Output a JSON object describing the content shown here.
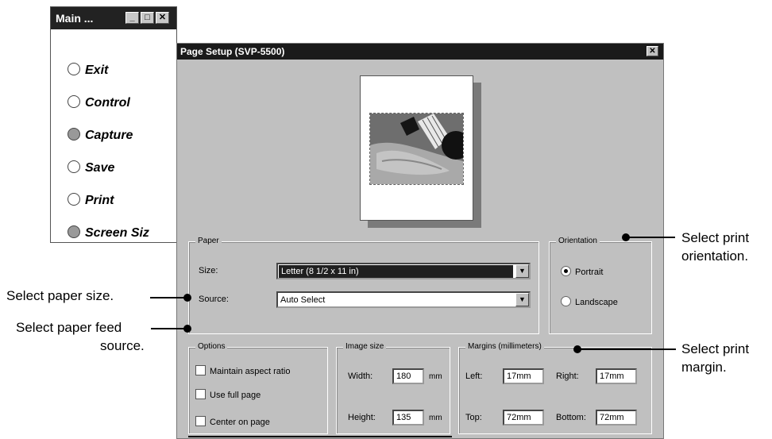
{
  "main_window": {
    "title": "Main ...",
    "minimize_glyph": "_",
    "maximize_glyph": "□",
    "close_glyph": "✕",
    "items": [
      {
        "label": "Exit",
        "selected": false
      },
      {
        "label": "Control",
        "selected": false
      },
      {
        "label": "Capture",
        "selected": true
      },
      {
        "label": "Save",
        "selected": false
      },
      {
        "label": "Print",
        "selected": false
      },
      {
        "label": "Screen Siz",
        "selected": true
      }
    ]
  },
  "dialog": {
    "title": "Page Setup (SVP-5500)",
    "close_glyph": "✕",
    "paper": {
      "group_label": "Paper",
      "size_label": "Size:",
      "size_value": "Letter (8 1/2 x 11 in)",
      "source_label": "Source:",
      "source_value": "Auto Select",
      "dropdown_glyph": "▼"
    },
    "orientation": {
      "group_label": "Orientation",
      "portrait": "Portrait",
      "landscape": "Landscape",
      "selected": "Portrait"
    },
    "options": {
      "group_label": "Options",
      "maintain": "Maintain aspect ratio",
      "full_page": "Use full page",
      "center": "Center on page"
    },
    "image_size": {
      "group_label": "Image size",
      "width_label": "Width:",
      "width_value": "180",
      "height_label": "Height:",
      "height_value": "135",
      "unit": "mm"
    },
    "margins": {
      "group_label": "Margins (millimeters)",
      "left_label": "Left:",
      "left_value": "17mm",
      "right_label": "Right:",
      "right_value": "17mm",
      "top_label": "Top:",
      "top_value": "72mm",
      "bottom_label": "Bottom:",
      "bottom_value": "72mm"
    }
  },
  "callouts": {
    "paper_size": "Select paper size.",
    "feed_1": "Select paper feed",
    "feed_2": "source.",
    "orient_1": "Select print",
    "orient_2": "orientation.",
    "margin_1": "Select print",
    "margin_2": "margin."
  }
}
